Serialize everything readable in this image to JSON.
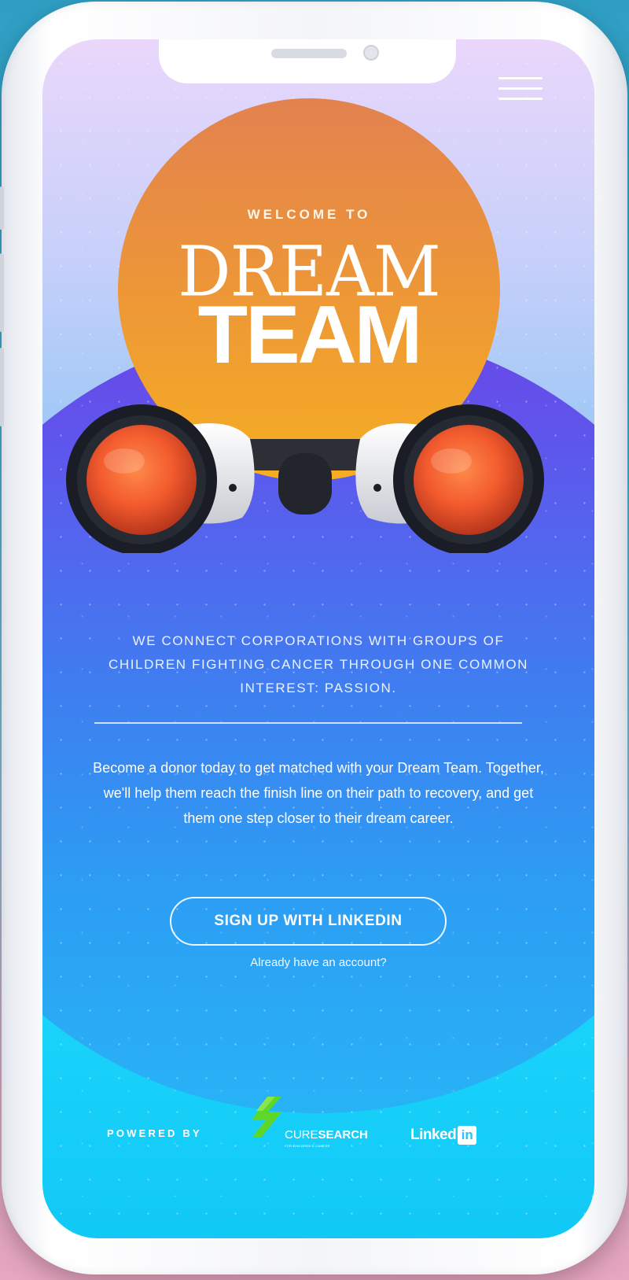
{
  "hero": {
    "welcome": "WELCOME TO",
    "title_line1": "DREAM",
    "title_line2": "TEAM"
  },
  "tagline": "WE CONNECT CORPORATIONS WITH GROUPS OF CHILDREN FIGHTING CANCER THROUGH ONE COMMON INTEREST: PASSION.",
  "description": "Become a donor today to get matched with your Dream Team. Together, we'll help them reach the finish line on their path to recovery, and get them one step closer to their dream career.",
  "cta": {
    "label": "SIGN UP WITH LINKEDIN"
  },
  "login_link": "Already have an account?",
  "footer": {
    "powered_by": "POWERED BY",
    "curesearch_prefix": "CURE",
    "curesearch_bold": "SEARCH",
    "curesearch_sub": "FOR CHILDREN'S CANCER",
    "linkedin_word": "Linked",
    "linkedin_badge": "in"
  },
  "colors": {
    "sun_top": "#e2824f",
    "sun_bottom": "#f6ae22",
    "circle_top": "#6a46e8",
    "circle_bottom": "#28b3f6",
    "screen_bottom": "#12c9f6",
    "curesearch_green": "#5fd62a"
  },
  "icons": {
    "menu": "hamburger-menu-icon",
    "binoculars": "binoculars-illustration",
    "curesearch": "curesearch-logo-icon",
    "linkedin": "linkedin-logo-icon"
  }
}
